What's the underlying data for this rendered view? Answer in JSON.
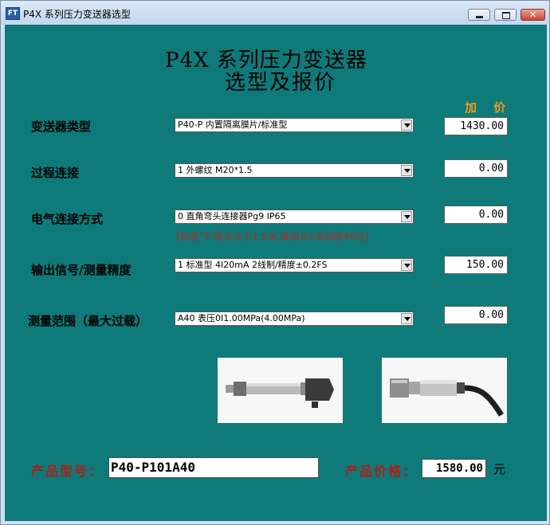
{
  "window": {
    "icon_text": "FT",
    "title": "P4X 系列压力变送器选型"
  },
  "heading": {
    "line1": "P4X 系列压力变送器",
    "line2": "选型及报价"
  },
  "price_header": "加 价",
  "rows": [
    {
      "label": "变送器类型",
      "selected": "P40-P 内置隔离膜片/标准型",
      "price": "1430.00"
    },
    {
      "label": "过程连接",
      "selected": "1 外螺纹 M20*1.5",
      "price": "0.00"
    },
    {
      "label": "电气连接方式",
      "selected": "0 直角弯头连接器Pg9 IP65",
      "price": "0.00",
      "note": "[如选\"3\"缆长大于1.5米,每加长1米加收40元]"
    },
    {
      "label": "输出信号/测量精度",
      "selected": "1 标准型 4I20mA 2线制/精度±0.2FS",
      "price": "150.00"
    },
    {
      "label": "测量范围（最大过载）",
      "selected": "A40 表压0I1.00MPa(4.00MPa)",
      "price": "0.00"
    }
  ],
  "bottom": {
    "model_label": "产品型号：",
    "model_value": "P40-P101A40",
    "price_label": "产品价格：",
    "price_value": "1580.00",
    "currency": "元"
  }
}
